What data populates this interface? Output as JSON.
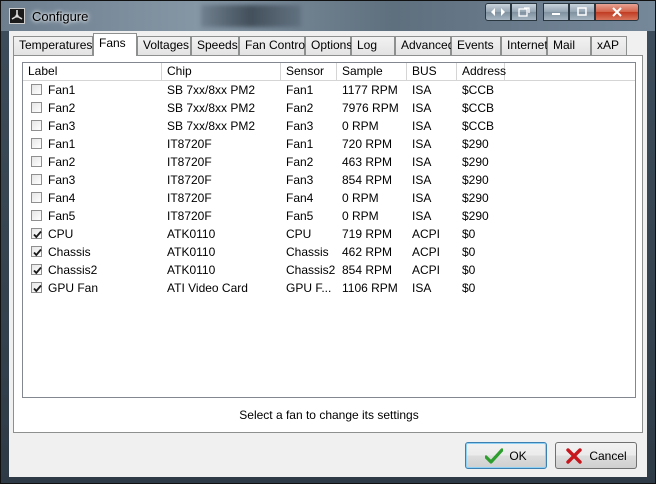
{
  "window": {
    "title": "Configure"
  },
  "tabs": [
    {
      "label": "Temperatures"
    },
    {
      "label": "Fans"
    },
    {
      "label": "Voltages"
    },
    {
      "label": "Speeds"
    },
    {
      "label": "Fan Control"
    },
    {
      "label": "Options"
    },
    {
      "label": "Log"
    },
    {
      "label": "Advanced"
    },
    {
      "label": "Events"
    },
    {
      "label": "Internet"
    },
    {
      "label": "Mail"
    },
    {
      "label": "xAP"
    }
  ],
  "active_tab": "Fans",
  "table": {
    "columns": [
      "Label",
      "Chip",
      "Sensor",
      "Sample",
      "BUS",
      "Address"
    ],
    "rows": [
      {
        "checked": false,
        "label": "Fan1",
        "chip": "SB 7xx/8xx PM2",
        "sensor": "Fan1",
        "sample": "1177 RPM",
        "bus": "ISA",
        "address": "$CCB"
      },
      {
        "checked": false,
        "label": "Fan2",
        "chip": "SB 7xx/8xx PM2",
        "sensor": "Fan2",
        "sample": "7976 RPM",
        "bus": "ISA",
        "address": "$CCB"
      },
      {
        "checked": false,
        "label": "Fan3",
        "chip": "SB 7xx/8xx PM2",
        "sensor": "Fan3",
        "sample": "0 RPM",
        "bus": "ISA",
        "address": "$CCB"
      },
      {
        "checked": false,
        "label": "Fan1",
        "chip": "IT8720F",
        "sensor": "Fan1",
        "sample": "720 RPM",
        "bus": "ISA",
        "address": "$290"
      },
      {
        "checked": false,
        "label": "Fan2",
        "chip": "IT8720F",
        "sensor": "Fan2",
        "sample": "463 RPM",
        "bus": "ISA",
        "address": "$290"
      },
      {
        "checked": false,
        "label": "Fan3",
        "chip": "IT8720F",
        "sensor": "Fan3",
        "sample": "854 RPM",
        "bus": "ISA",
        "address": "$290"
      },
      {
        "checked": false,
        "label": "Fan4",
        "chip": "IT8720F",
        "sensor": "Fan4",
        "sample": "0 RPM",
        "bus": "ISA",
        "address": "$290"
      },
      {
        "checked": false,
        "label": "Fan5",
        "chip": "IT8720F",
        "sensor": "Fan5",
        "sample": "0 RPM",
        "bus": "ISA",
        "address": "$290"
      },
      {
        "checked": true,
        "label": "CPU",
        "chip": "ATK0110",
        "sensor": "CPU",
        "sample": "719 RPM",
        "bus": "ACPI",
        "address": "$0"
      },
      {
        "checked": true,
        "label": "Chassis",
        "chip": "ATK0110",
        "sensor": "Chassis",
        "sample": "462 RPM",
        "bus": "ACPI",
        "address": "$0"
      },
      {
        "checked": true,
        "label": "Chassis2",
        "chip": "ATK0110",
        "sensor": "Chassis2",
        "sample": "854 RPM",
        "bus": "ACPI",
        "address": "$0"
      },
      {
        "checked": true,
        "label": "GPU Fan",
        "chip": "ATI Video Card",
        "sensor": "GPU F...",
        "sample": "1106 RPM",
        "bus": "ISA",
        "address": "$0"
      }
    ]
  },
  "hint": "Select a fan to change its settings",
  "buttons": {
    "ok": "OK",
    "cancel": "Cancel"
  },
  "icons": {
    "app": "speedfan-icon",
    "ok": "green-check-icon",
    "cancel": "red-x-icon"
  },
  "colors": {
    "ok_check": "#2e9e2e",
    "cancel_x": "#c8161d",
    "close_button": "#c03b22"
  }
}
